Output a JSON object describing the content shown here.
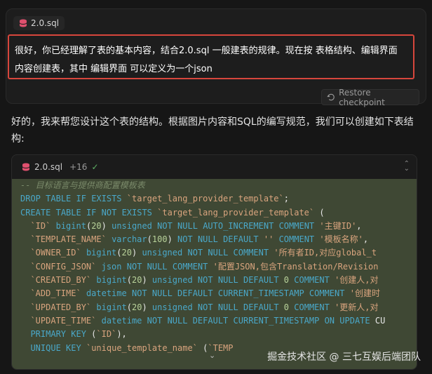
{
  "user_message": {
    "file_chip": "2.0.sql",
    "text": "很好，你已经理解了表的基本内容，结合2.0.sql 一般建表的规律。现在按 表格结构、编辑界面 内容创建表，其中 编辑界面 可以定义为一个json",
    "restore_button": "Restore checkpoint"
  },
  "reply_text": "好的，我来帮您设计这个表的结构。根据图片内容和SQL的编写规范，我们可以创建如下表结构:",
  "code_block": {
    "file_name": "2.0.sql",
    "diff": "+16",
    "lines": [
      "-- 目标语言与提供商配置模板表",
      "DROP TABLE IF EXISTS `target_lang_provider_template`;",
      "CREATE TABLE IF NOT EXISTS `target_lang_provider_template` (",
      "  `ID` bigint(20) unsigned NOT NULL AUTO_INCREMENT COMMENT '主键ID',",
      "  `TEMPLATE_NAME` varchar(100) NOT NULL DEFAULT '' COMMENT '模板名称',",
      "  `OWNER_ID` bigint(20) unsigned NOT NULL COMMENT '所有者ID,对应global_t",
      "  `CONFIG_JSON` json NOT NULL COMMENT '配置JSON,包含Translation/Revision",
      "  `CREATED_BY` bigint(20) unsigned NOT NULL DEFAULT 0 COMMENT '创建人,对",
      "  `ADD_TIME` datetime NOT NULL DEFAULT CURRENT_TIMESTAMP COMMENT '创建时",
      "  `UPDATED_BY` bigint(20) unsigned NOT NULL DEFAULT 0 COMMENT '更新人,对",
      "  `UPDATE_TIME` datetime NOT NULL DEFAULT CURRENT_TIMESTAMP ON UPDATE CU",
      "  PRIMARY KEY (`ID`),",
      "  UNIQUE KEY `unique_template_name` (`TEMP"
    ]
  },
  "watermark": "掘金技术社区 @ 三七互娱后端团队",
  "colors": {
    "background": "#161616",
    "highlight_border": "#d7463c",
    "code_bg": "#3f4834",
    "keyword": "#4aa8c9",
    "string": "#d9a47e",
    "check": "#5fb065"
  },
  "icons": [
    "database-icon",
    "restore-icon",
    "check-icon",
    "collapse-icon",
    "chevron-down-icon"
  ]
}
